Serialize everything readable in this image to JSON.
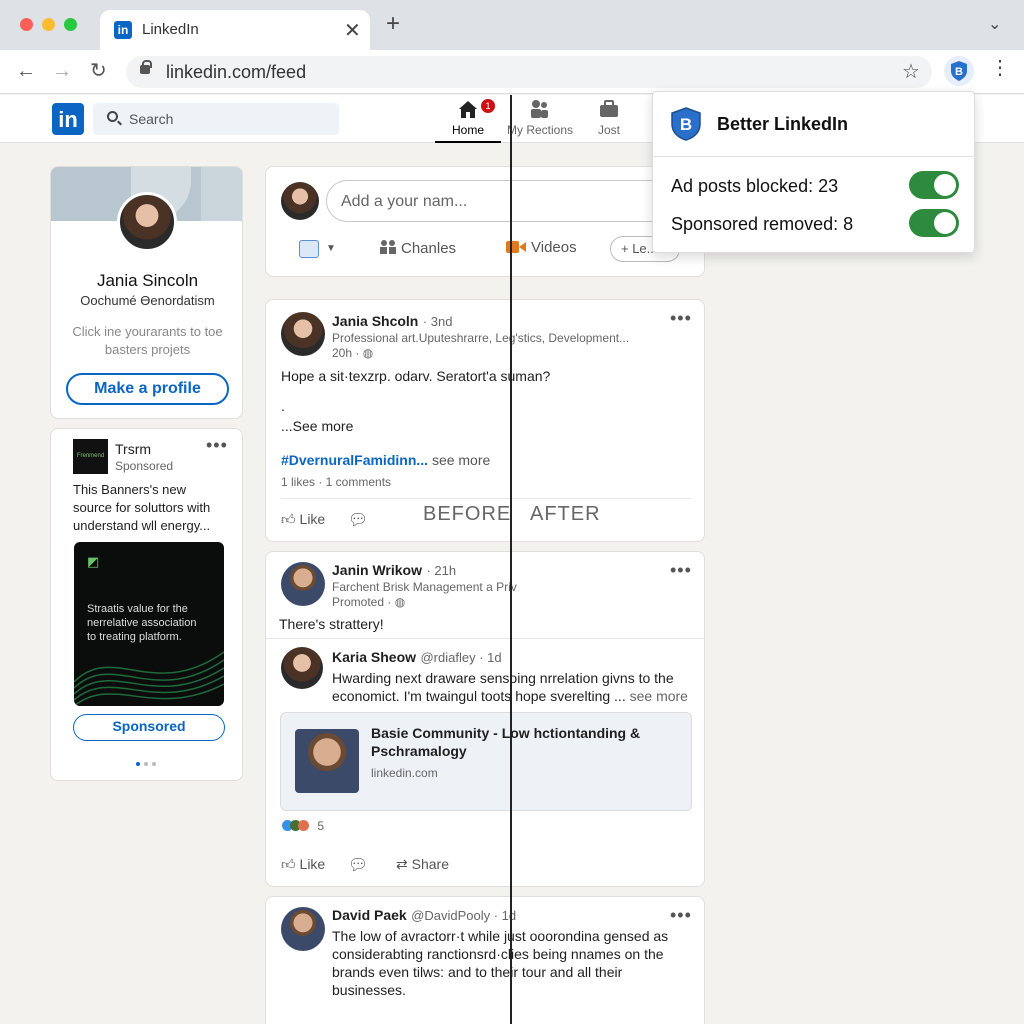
{
  "browser": {
    "tab_title": "LinkedIn",
    "tab_close": "✕",
    "new_tab": "+",
    "url": "linkedin.com/feed",
    "back": "←",
    "forward": "→",
    "reload": "↻",
    "star": "☆",
    "menu": "⋮",
    "tab_list": "⌄"
  },
  "header": {
    "logo": "in",
    "search_placeholder": "Search",
    "nav": [
      {
        "label": "Home",
        "badge": "1"
      },
      {
        "label": "My Rections"
      },
      {
        "label": "Jost"
      }
    ]
  },
  "extension_popup": {
    "icon_letter": "B",
    "title": "Better LinkedIn",
    "rows": [
      {
        "label": "Ad posts blocked: 23",
        "on": true
      },
      {
        "label": "Sponsored removed: 8",
        "on": true
      }
    ]
  },
  "profile_card": {
    "name": "Jania Sincoln",
    "headline": "Oochumé Өenordatism",
    "prompt_line1": "Click ine yourarants to toe",
    "prompt_line2": "basters projets",
    "button": "Make a profile"
  },
  "ad_card": {
    "name": "Trsrm",
    "logo_text": "Frenmend",
    "tag": "Sponsored",
    "text_line1": "This Banners's new",
    "text_line2": "source for soluttors with",
    "text_line3": "understand wll energy...",
    "image_mark": "◩",
    "image_text_line1": "Straatis value for the",
    "image_text_line2": "nerrelative association",
    "image_text_line3": "to treating platform.",
    "button": "Sponsored"
  },
  "composer": {
    "placeholder": "Add a your nam...",
    "actions": [
      {
        "label": "Chanles"
      },
      {
        "label": "Videos"
      },
      {
        "label": "+ Le..."
      }
    ]
  },
  "comparison": {
    "before": "BEFORE",
    "after": "AFTER"
  },
  "posts": [
    {
      "name": "Jania Shcoln",
      "degree": "· 3nd",
      "headline": "Professional art.Uputeshrarre, Leg'stics, Development...",
      "time": "20h ·",
      "text": "Hope a sit·texzrp. odarv. Seratort'a suman?",
      "dot": ".",
      "see_more": "...See more",
      "hashtag": "#DvernuralFamidinn...",
      "hashtag_more": "see more",
      "stats": "1 likes · 1 comments",
      "like": "Like"
    },
    {
      "name": "Janin Wrikow",
      "degree": "· 21h",
      "headline": "Farchent Brisk Management a Priv",
      "promoted": "Promoted ·",
      "text": "There's strattery!",
      "nested_name": "Karia Sheow",
      "nested_handle": "@rdiafley · 1d",
      "nested_text_line1": "Hwarding next draware sensoing nrrelation givns to the",
      "nested_text_line2": "economict. I'm twaingul toots hope sverelting ...",
      "nested_more": "see more",
      "link_title_line1": "Basie Community - Low hctiontanding &",
      "link_title_line2": "Pschramalogy",
      "link_domain": "linkedin.com",
      "reactions": "5",
      "like": "Like",
      "share": "Share"
    },
    {
      "name": "David Paek",
      "handle": "@DavidPooly · 1d",
      "text_line1": "The low of avractorr·t while just ooorondina gensed as",
      "text_line2": "considerabting ranctionsrd·clies being nnames on the",
      "text_line3": "brands even tilws: and to their tour and all their",
      "text_line4": "businesses."
    }
  ],
  "colors": {
    "brand": "#0a66c2",
    "toggle_on": "#2e8b3e",
    "badge": "#cc1016"
  }
}
